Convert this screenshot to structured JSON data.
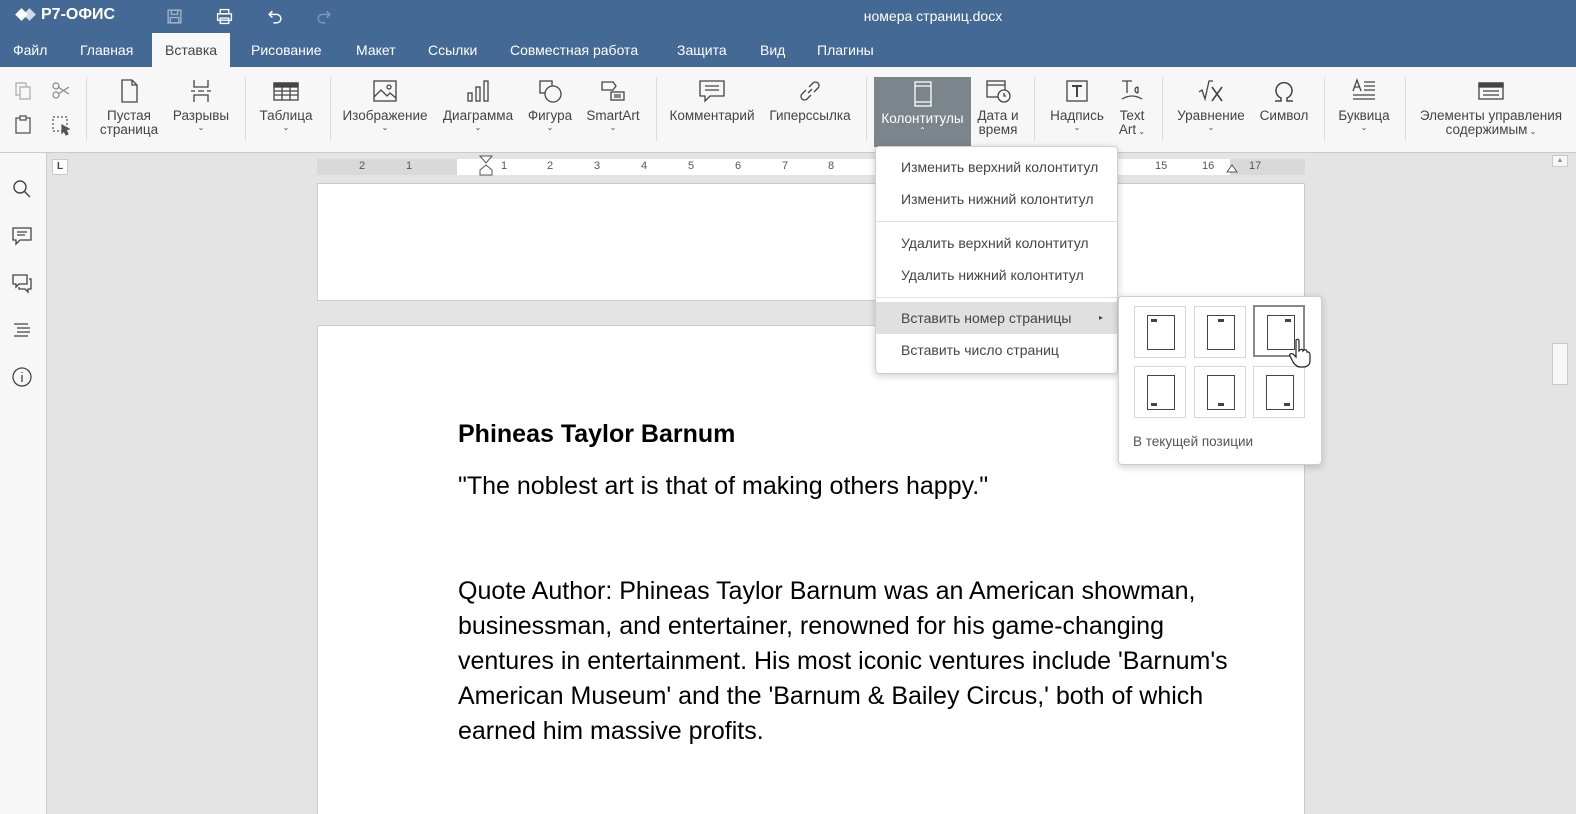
{
  "app": {
    "brand": "Р7-ОФИС",
    "document_title": "номера страниц.docx"
  },
  "menu": {
    "tabs": [
      "Файл",
      "Главная",
      "Вставка",
      "Рисование",
      "Макет",
      "Ссылки",
      "Совместная работа",
      "Защита",
      "Вид",
      "Плагины"
    ],
    "active": "Вставка"
  },
  "toolbar": {
    "blank_page": {
      "line1": "Пустая",
      "line2": "страница"
    },
    "breaks": "Разрывы",
    "table": "Таблица",
    "image": "Изображение",
    "chart": "Диаграмма",
    "shape": "Фигура",
    "smartart": "SmartArt",
    "comment": "Комментарий",
    "hyperlink": "Гиперссылка",
    "header_footer": "Колонтитулы",
    "datetime": {
      "line1": "Дата и",
      "line2": "время"
    },
    "textbox": "Надпись",
    "textart": {
      "line1": "Text",
      "line2": "Art"
    },
    "equation": "Уравнение",
    "symbol": "Символ",
    "dropcap": "Буквица",
    "content_controls": {
      "line1": "Элементы управления",
      "line2": "содержимым"
    }
  },
  "ruler": {
    "corner": "L",
    "numbers": [
      "2",
      "1",
      "1",
      "2",
      "3",
      "4",
      "5",
      "6",
      "7",
      "8",
      "15",
      "16",
      "17"
    ]
  },
  "document": {
    "heading": "Phineas Taylor Barnum",
    "quote": "\"The noblest art is that of making others happy.\"",
    "paragraph": "Quote Author: Phineas Taylor Barnum was an American showman, businessman, and entertainer, renowned for his game-changing ventures in entertainment. His most iconic ventures include 'Barnum's American Museum' and the 'Barnum & Bailey Circus,' both of which earned him massive profits."
  },
  "header_footer_menu": {
    "edit_header": "Изменить верхний колонтитул",
    "edit_footer": "Изменить нижний колонтитул",
    "remove_header": "Удалить верхний колонтитул",
    "remove_footer": "Удалить нижний колонтитул",
    "insert_page_number": "Вставить номер страницы",
    "insert_page_count": "Вставить число страниц"
  },
  "page_number_submenu": {
    "positions": [
      "top-left",
      "top-center",
      "top-right",
      "bottom-left",
      "bottom-center",
      "bottom-right"
    ],
    "selected": "top-right",
    "current_position": "В текущей позиции"
  },
  "colors": {
    "header_bar": "#446995",
    "toolbar_bg": "#f7f7f7",
    "pressed_button": "#7d858c"
  }
}
